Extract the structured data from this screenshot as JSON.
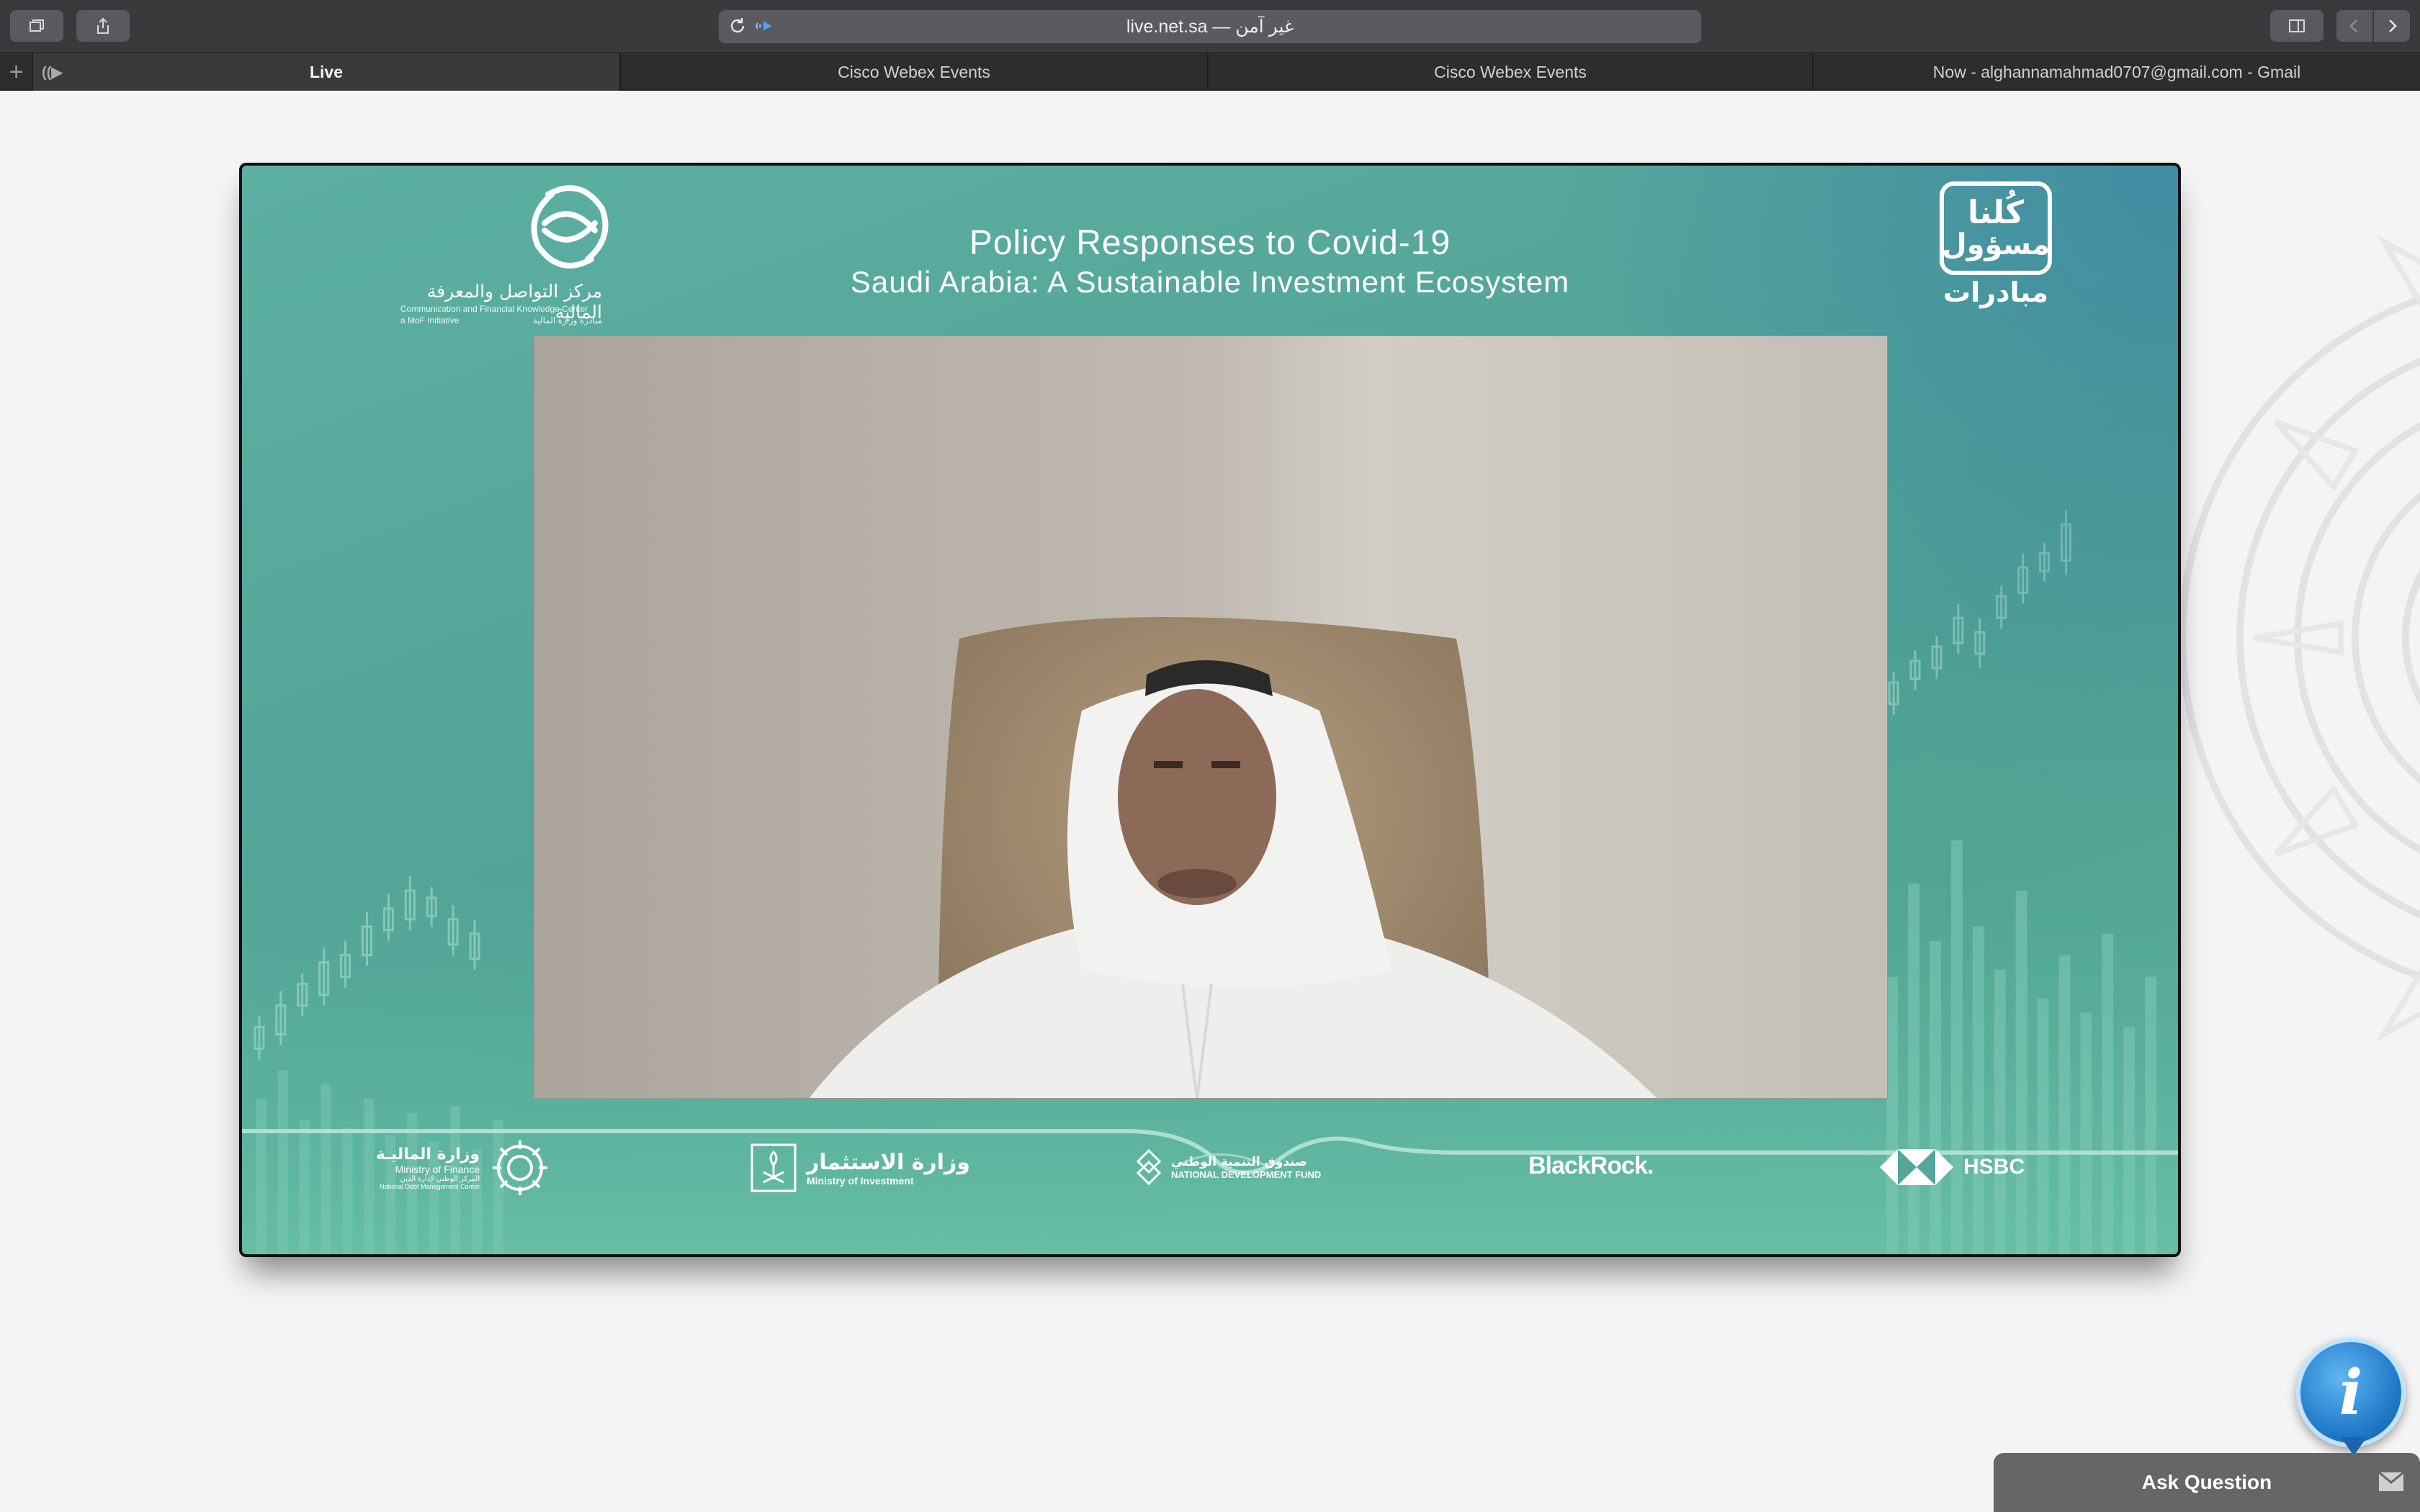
{
  "browser": {
    "url_text": "live.net.sa — غير آمن",
    "tabs": [
      {
        "label": "Live",
        "active": true
      },
      {
        "label": "Cisco Webex Events",
        "active": false
      },
      {
        "label": "Cisco Webex Events",
        "active": false
      },
      {
        "label": "Now - alghannamahmad0707@gmail.com - Gmail",
        "active": false
      }
    ]
  },
  "event": {
    "title": "Policy Responses to Covid-19",
    "subtitle": "Saudi Arabia: A Sustainable Investment Ecosystem",
    "logo_left": {
      "arabic": "مركز التواصل والمعرفة المالية",
      "english": "Communication and Financial Knowledge Center",
      "initiative": "a MoF Initiative",
      "initiative_ar": "مبادرة وزارة المالية"
    },
    "logo_right": {
      "line1": "كُلنا",
      "line2": "مسؤول",
      "sub": "مبادرات"
    }
  },
  "sponsors": {
    "mof_ar": "وزارة الماليـة",
    "mof_en": "Ministry of Finance",
    "mof_sub_ar": "المركز الوطني لإدارة الدين",
    "mof_sub_en": "National Debt Management Center",
    "moi_ar": "وزارة الاستثمار",
    "moi_en": "Ministry of Investment",
    "ndf_ar": "صندوق التنمية الوطني",
    "ndf_en": "NATIONAL DEVELOPMENT FUND",
    "blackrock": "BlackRock.",
    "hsbc": "HSBC"
  },
  "widgets": {
    "info_glyph": "i",
    "ask_question": "Ask Question"
  },
  "colors": {
    "player_teal": "#55a69a",
    "toolbar": "#3a3a3c",
    "info_blue": "#1f78c7"
  }
}
